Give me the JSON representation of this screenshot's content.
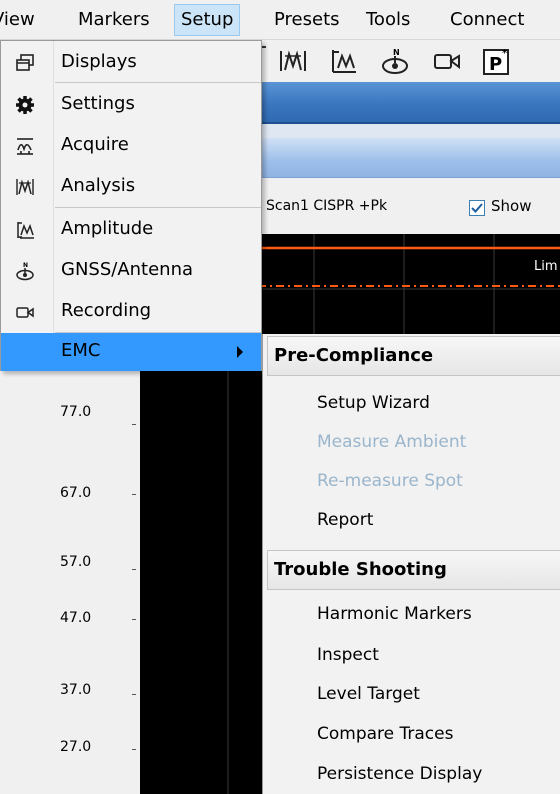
{
  "menubar": {
    "items": [
      {
        "label": "View"
      },
      {
        "label": "Markers"
      },
      {
        "label": "Setup"
      },
      {
        "label": "Presets"
      },
      {
        "label": "Tools"
      },
      {
        "label": "Connect"
      }
    ],
    "active": "Setup"
  },
  "toolbar": {
    "icons": [
      "analysis-icon",
      "amplitude-icon",
      "gnss-antenna-icon",
      "recording-icon",
      "preset-p-icon"
    ]
  },
  "trace": {
    "scan_label": "Scan1 CISPR +Pk",
    "show_label": "Show",
    "show_checked": true
  },
  "plot": {
    "limit_label": "Lim",
    "y_axis_labels": [
      "77.0",
      "67.0",
      "57.0",
      "47.0",
      "37.0",
      "27.0"
    ],
    "colors": {
      "limit_solid": "#ff5a14",
      "limit_dashed": "#ff5a14",
      "background": "#000000"
    }
  },
  "setup_menu": {
    "items": [
      {
        "label": "Displays",
        "icon": "displays-icon"
      },
      {
        "label": "Settings",
        "icon": "gear-icon"
      },
      {
        "label": "Acquire",
        "icon": "acquire-icon"
      },
      {
        "label": "Analysis",
        "icon": "analysis-icon"
      },
      {
        "label": "Amplitude",
        "icon": "amplitude-icon"
      },
      {
        "label": "GNSS/Antenna",
        "icon": "gnss-antenna-icon"
      },
      {
        "label": "Recording",
        "icon": "recording-icon"
      },
      {
        "label": "EMC",
        "icon": "",
        "highlighted": true,
        "has_submenu": true
      }
    ],
    "highlight_color": "#3399ff"
  },
  "emc_menu": {
    "sections": [
      {
        "header": "Pre-Compliance",
        "items": [
          {
            "label": "Setup Wizard",
            "enabled": true
          },
          {
            "label": "Measure Ambient",
            "enabled": false
          },
          {
            "label": "Re-measure Spot",
            "enabled": false
          },
          {
            "label": "Report",
            "enabled": true
          }
        ]
      },
      {
        "header": "Trouble Shooting",
        "items": [
          {
            "label": "Harmonic Markers",
            "enabled": true
          },
          {
            "label": "Inspect",
            "enabled": true
          },
          {
            "label": "Level Target",
            "enabled": true
          },
          {
            "label": "Compare Traces",
            "enabled": true
          },
          {
            "label": "Persistence Display",
            "enabled": true
          }
        ]
      }
    ]
  }
}
